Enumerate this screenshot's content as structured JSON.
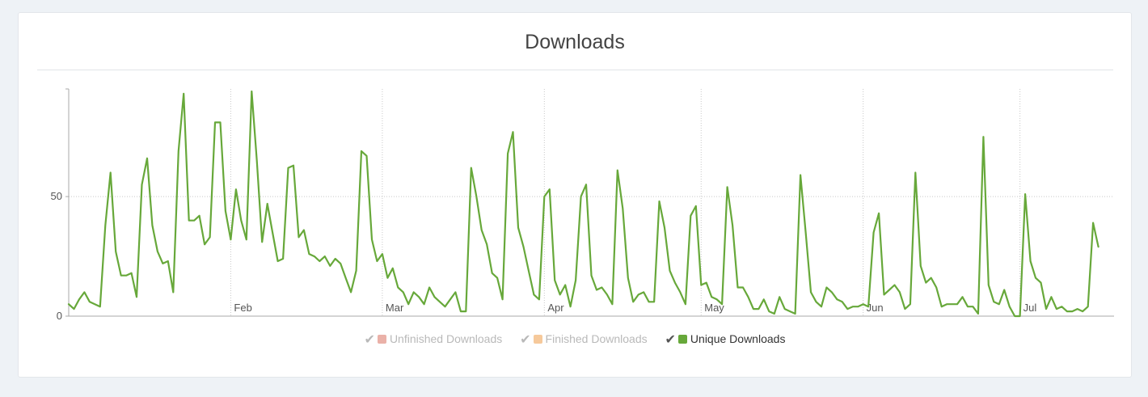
{
  "colors": {
    "unique": "#67a83a",
    "finished": "#f6c99b",
    "unfinished": "#eab1a8",
    "axis": "#aaaaaa",
    "grid": "#c8c8c8",
    "tick_text": "#555555"
  },
  "chart_data": {
    "type": "line",
    "title": "Downloads",
    "xlabel": "",
    "ylabel": "",
    "ylim": [
      0,
      95
    ],
    "yticks": [
      0,
      50
    ],
    "grid": true,
    "legend_placement": "bottom",
    "x_domain": [
      "2016-01-01",
      "2016-07-19"
    ],
    "x_ticks": [
      {
        "label": "Feb",
        "date": "2016-02-01"
      },
      {
        "label": "Mar",
        "date": "2016-03-01"
      },
      {
        "label": "Apr",
        "date": "2016-04-01"
      },
      {
        "label": "May",
        "date": "2016-05-01"
      },
      {
        "label": "Jun",
        "date": "2016-06-01"
      },
      {
        "label": "Jul",
        "date": "2016-07-01"
      }
    ],
    "legend": [
      {
        "name": "Unfinished Downloads",
        "active": false,
        "color": "#eab1a8"
      },
      {
        "name": "Finished Downloads",
        "active": false,
        "color": "#f6c99b"
      },
      {
        "name": "Unique Downloads",
        "active": true,
        "color": "#67a83a"
      }
    ],
    "series": [
      {
        "name": "Unique Downloads",
        "start_date": "2016-01-01",
        "interval": "day",
        "values": [
          5,
          3,
          7,
          10,
          6,
          5,
          4,
          38,
          60,
          27,
          17,
          17,
          18,
          8,
          55,
          66,
          38,
          27,
          22,
          23,
          10,
          69,
          93,
          40,
          40,
          42,
          30,
          33,
          81,
          81,
          44,
          32,
          53,
          40,
          32,
          94,
          65,
          31,
          47,
          35,
          23,
          24,
          62,
          63,
          33,
          36,
          26,
          25,
          23,
          25,
          21,
          24,
          22,
          16,
          10,
          19,
          69,
          67,
          32,
          23,
          26,
          16,
          20,
          12,
          10,
          5,
          10,
          8,
          5,
          12,
          8,
          6,
          4,
          7,
          10,
          2,
          2,
          62,
          50,
          36,
          30,
          18,
          16,
          7,
          68,
          77,
          37,
          29,
          19,
          9,
          7,
          50,
          53,
          15,
          9,
          13,
          4,
          15,
          50,
          55,
          17,
          11,
          12,
          9,
          5,
          61,
          45,
          16,
          6,
          9,
          10,
          6,
          6,
          48,
          37,
          19,
          14,
          10,
          5,
          42,
          46,
          13,
          14,
          8,
          7,
          5,
          54,
          38,
          12,
          12,
          8,
          3,
          3,
          7,
          2,
          1,
          8,
          3,
          2,
          1,
          59,
          35,
          10,
          6,
          4,
          12,
          10,
          7,
          6,
          3,
          4,
          4,
          5,
          4,
          35,
          43,
          9,
          11,
          13,
          10,
          3,
          5,
          60,
          21,
          14,
          16,
          12,
          4,
          5,
          5,
          5,
          8,
          4,
          4,
          1,
          75,
          13,
          6,
          5,
          11,
          4,
          0,
          0,
          51,
          23,
          16,
          14,
          3,
          8,
          3,
          4,
          2,
          2,
          3,
          2,
          4,
          39,
          29
        ]
      }
    ]
  }
}
